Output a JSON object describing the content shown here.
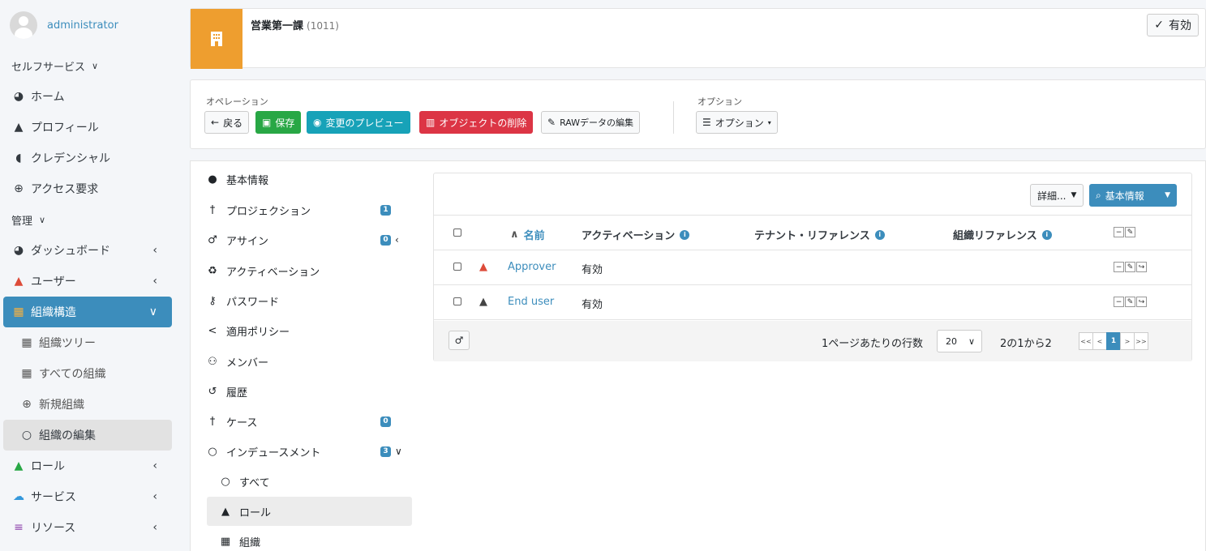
{
  "sidebar": {
    "user_name": "administrator",
    "self_service_header": "セルフサービス",
    "self_service_items": [
      {
        "label": "ホーム",
        "icon": "tachometer-icon"
      },
      {
        "label": "プロフィール",
        "icon": "user-icon"
      },
      {
        "label": "クレデンシャル",
        "icon": "shield-icon"
      },
      {
        "label": "アクセス要求",
        "icon": "plus-circle-icon"
      }
    ],
    "admin_header": "管理",
    "admin_items": [
      {
        "label": "ダッシュボード"
      },
      {
        "label": "ユーザー"
      },
      {
        "label": "組織構造"
      },
      {
        "label": "組織ツリー"
      },
      {
        "label": "すべての組織"
      },
      {
        "label": "新規組織"
      },
      {
        "label": "組織の編集"
      },
      {
        "label": "ロール"
      },
      {
        "label": "サービス"
      },
      {
        "label": "リソース"
      }
    ]
  },
  "header": {
    "title": "営業第一課",
    "code": "(1011)",
    "status": "有効"
  },
  "operations": {
    "label": "オペレーション",
    "back": "戻る",
    "save": "保存",
    "preview": "変更のプレビュー",
    "delete": "オブジェクトの削除",
    "raw_edit": "RAWデータの編集",
    "options_label": "オプション",
    "options_button": "オプション"
  },
  "tabs": [
    {
      "label": "基本情報"
    },
    {
      "label": "プロジェクション",
      "badge": "1"
    },
    {
      "label": "アサイン",
      "badge": "0"
    },
    {
      "label": "アクティベーション"
    },
    {
      "label": "パスワード"
    },
    {
      "label": "適用ポリシー"
    },
    {
      "label": "メンバー"
    },
    {
      "label": "履歴"
    },
    {
      "label": "ケース",
      "badge": "0"
    },
    {
      "label": "インデュースメント",
      "badge": "3"
    },
    {
      "label": "すべて"
    },
    {
      "label": "ロール"
    },
    {
      "label": "組織"
    }
  ],
  "table": {
    "detail_button": "詳細...",
    "search_button": "基本情報",
    "columns": [
      "名前",
      "アクティベーション",
      "テナント・リファレンス",
      "組織リファレンス"
    ],
    "rows": [
      {
        "name": "Approver",
        "activation": "有効",
        "icon_color": "#dd4b39"
      },
      {
        "name": "End user",
        "activation": "有効",
        "icon_color": "#444444"
      }
    ],
    "rows_per_page_label": "1ページあたりの行数",
    "rows_per_page": "20",
    "range_text": "2の1から2",
    "pager": [
      "<<",
      "<",
      "1",
      ">",
      ">>"
    ]
  },
  "colors": {
    "accent": "#3c8dbc",
    "org_icon_bg": "#ee9e2f",
    "save": "#28a745",
    "preview": "#17a2b8",
    "delete": "#dc3545"
  }
}
